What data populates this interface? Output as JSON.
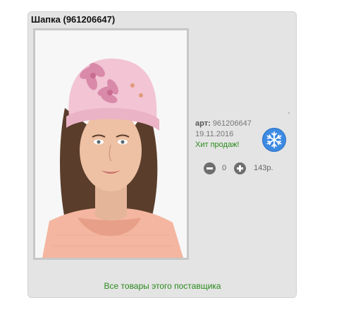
{
  "product": {
    "title": "Шапка (961206647)",
    "image_alt": "Шапка",
    "article_label": "арт:",
    "article_value": "961206647",
    "date": "19.11.2016",
    "hit_label": "Хит продаж!",
    "season_icon": "snowflake-icon"
  },
  "cart": {
    "quantity": "0",
    "price": "143р."
  },
  "footer": {
    "supplier_link": "Все товары этого поставщика"
  },
  "colors": {
    "card_bg": "#e4e4e4",
    "link_green": "#2a8a1c",
    "badge_blue": "#3d8ae2",
    "control_gray": "#6e6e6e"
  }
}
